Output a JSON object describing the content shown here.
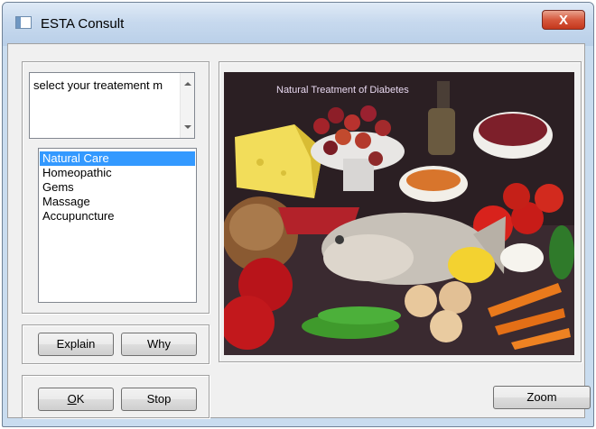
{
  "window": {
    "title": "ESTA Consult",
    "close_label": "X"
  },
  "prompt": {
    "text": "select your treatement m"
  },
  "treatments": {
    "items": [
      {
        "label": "Natural Care",
        "selected": true
      },
      {
        "label": "Homeopathic",
        "selected": false
      },
      {
        "label": "Gems",
        "selected": false
      },
      {
        "label": "Massage",
        "selected": false
      },
      {
        "label": "Accupuncture",
        "selected": false
      }
    ]
  },
  "buttons": {
    "explain": "Explain",
    "why": "Why",
    "ok_underlined": "O",
    "ok_rest": "K",
    "stop": "Stop",
    "zoom": "Zoom"
  },
  "image": {
    "caption": "Natural Treatment of Diabetes"
  },
  "colors": {
    "selection": "#3399ff",
    "close_button": "#d6583d",
    "window_frame": "#c9dcef",
    "dialog_bg": "#f0f0f0"
  }
}
